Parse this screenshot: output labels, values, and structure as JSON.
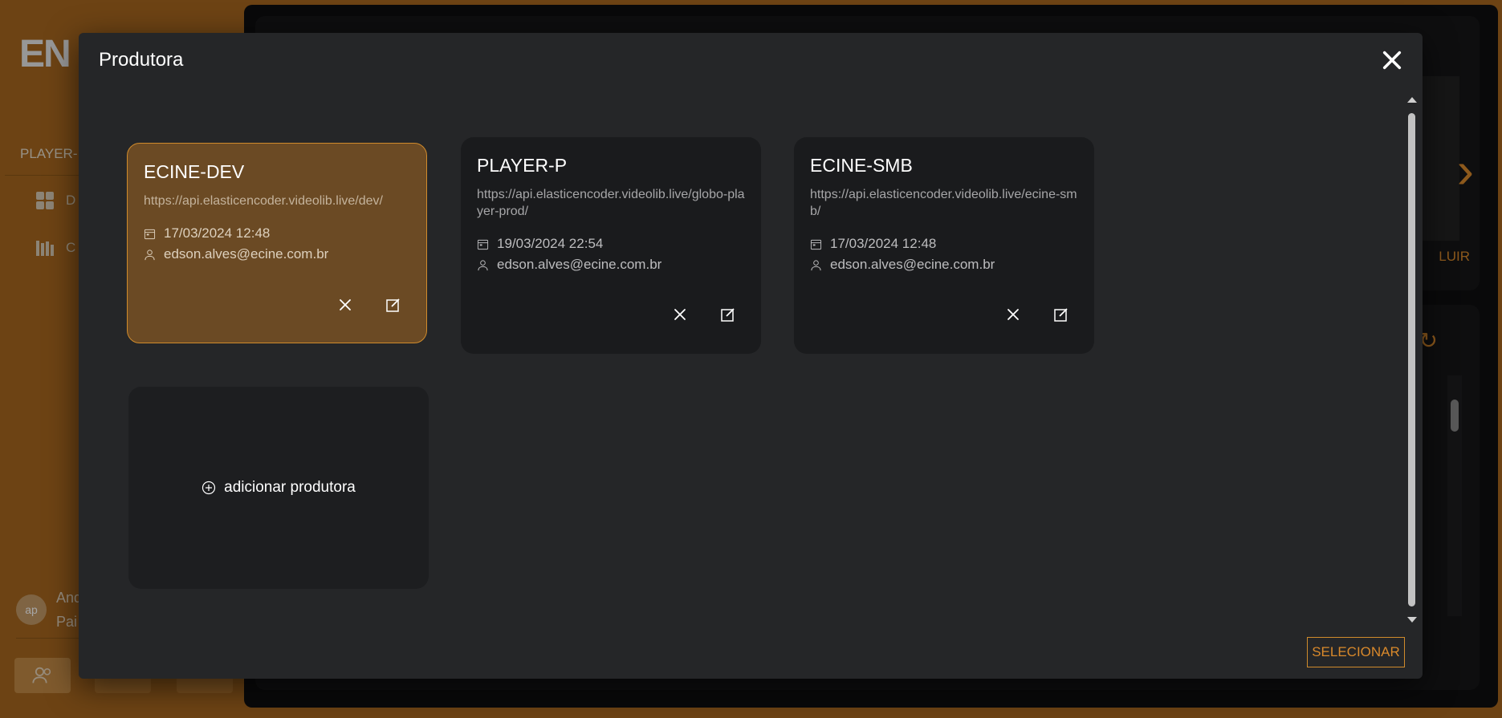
{
  "app": {
    "logo": "EN",
    "project_label": "PLAYER-",
    "sidebar_items": [
      {
        "label": "D",
        "icon": "dashboard-icon"
      },
      {
        "label": "C",
        "icon": "library-icon"
      }
    ],
    "user": {
      "initials": "ap",
      "name_line1": "And",
      "name_line2": "Pai"
    },
    "excluir_label": "LUIR"
  },
  "modal": {
    "title": "Produtora",
    "close_icon": "close-icon",
    "cards": [
      {
        "name": "ECINE-DEV",
        "url": "https://api.elasticencoder.videolib.live/dev/",
        "date": "17/03/2024 12:48",
        "user": "edson.alves@ecine.com.br",
        "selected": true
      },
      {
        "name": "PLAYER-P",
        "url": "https://api.elasticencoder.videolib.live/globo-player-prod/",
        "date": "19/03/2024 22:54",
        "user": "edson.alves@ecine.com.br",
        "selected": false
      },
      {
        "name": "ECINE-SMB",
        "url": "https://api.elasticencoder.videolib.live/ecine-smb/",
        "date": "17/03/2024 12:48",
        "user": "edson.alves@ecine.com.br",
        "selected": false
      }
    ],
    "add_label": "adicionar produtora",
    "select_label": "SELECIONAR"
  },
  "colors": {
    "accent": "#d9892b",
    "modal_bg": "#252628",
    "card_bg": "#1a1b1d",
    "selected_card_bg": "#6b4a24"
  }
}
